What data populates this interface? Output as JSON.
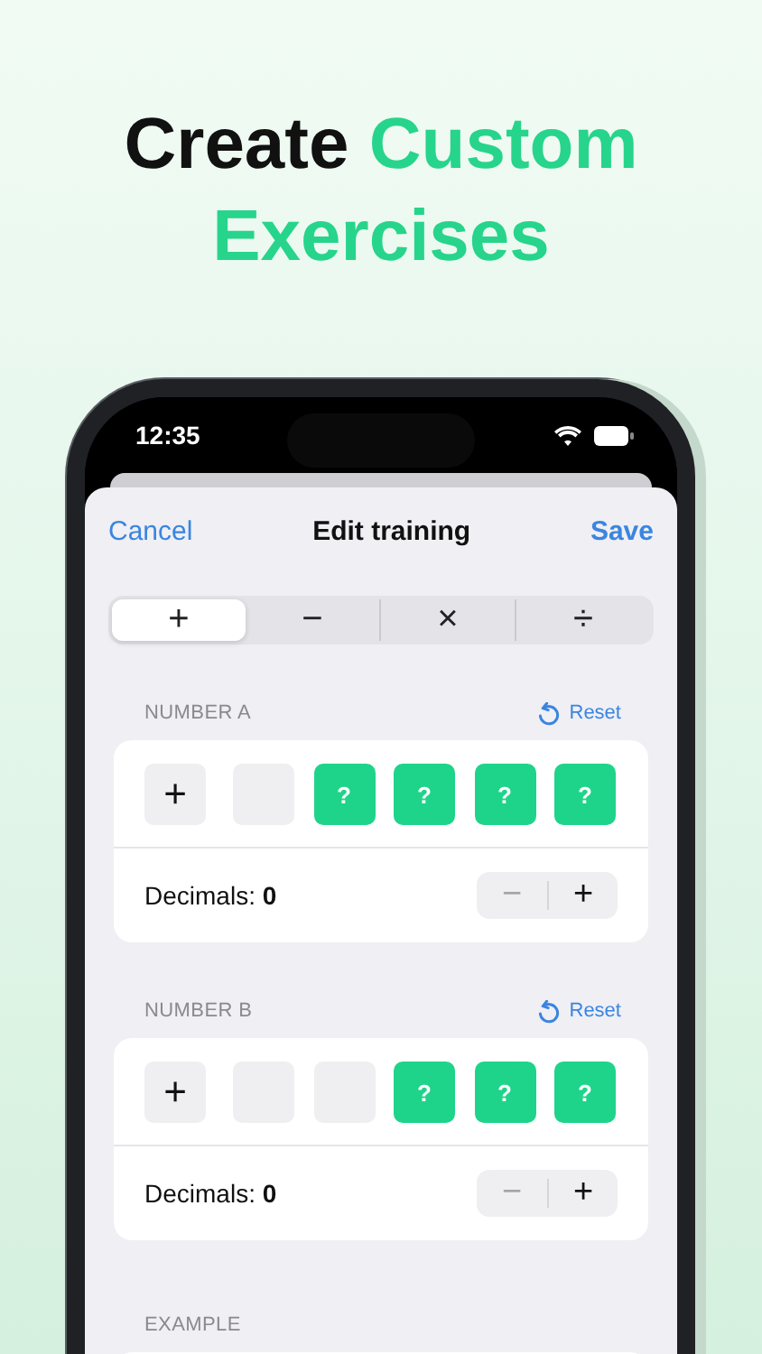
{
  "headline": [
    {
      "text": "Create",
      "highlight": false
    },
    {
      "text": "Custom",
      "highlight": true
    },
    {
      "text": "Exercises",
      "highlight": true
    }
  ],
  "status_bar": {
    "time": "12:35"
  },
  "nav": {
    "cancel": "Cancel",
    "title": "Edit training",
    "save": "Save"
  },
  "operations": [
    {
      "label": "+",
      "selected": true
    },
    {
      "label": "−",
      "selected": false
    },
    {
      "label": "×",
      "selected": false
    },
    {
      "label": "÷",
      "selected": false
    }
  ],
  "sections": [
    {
      "label": "NUMBER A",
      "reset": "Reset",
      "sign": "+",
      "slots": [
        {
          "filled": false
        },
        {
          "filled": true,
          "text": "?"
        },
        {
          "filled": true,
          "text": "?"
        },
        {
          "filled": true,
          "text": "?"
        },
        {
          "filled": true,
          "text": "?"
        }
      ],
      "decimals": "Decimals: **0**",
      "stepper": [
        {
          "label": "−",
          "disabled": true
        },
        {
          "label": "+",
          "disabled": false
        }
      ]
    },
    {
      "label": "NUMBER B",
      "reset": "Reset",
      "sign": "+",
      "slots": [
        {
          "filled": false
        },
        {
          "filled": false
        },
        {
          "filled": true,
          "text": "?"
        },
        {
          "filled": true,
          "text": "?"
        },
        {
          "filled": true,
          "text": "?"
        }
      ],
      "decimals": "Decimals: **0**",
      "stepper": [
        {
          "label": "−",
          "disabled": true
        },
        {
          "label": "+",
          "disabled": false
        }
      ]
    }
  ],
  "example": {
    "label": "EXAMPLE"
  }
}
